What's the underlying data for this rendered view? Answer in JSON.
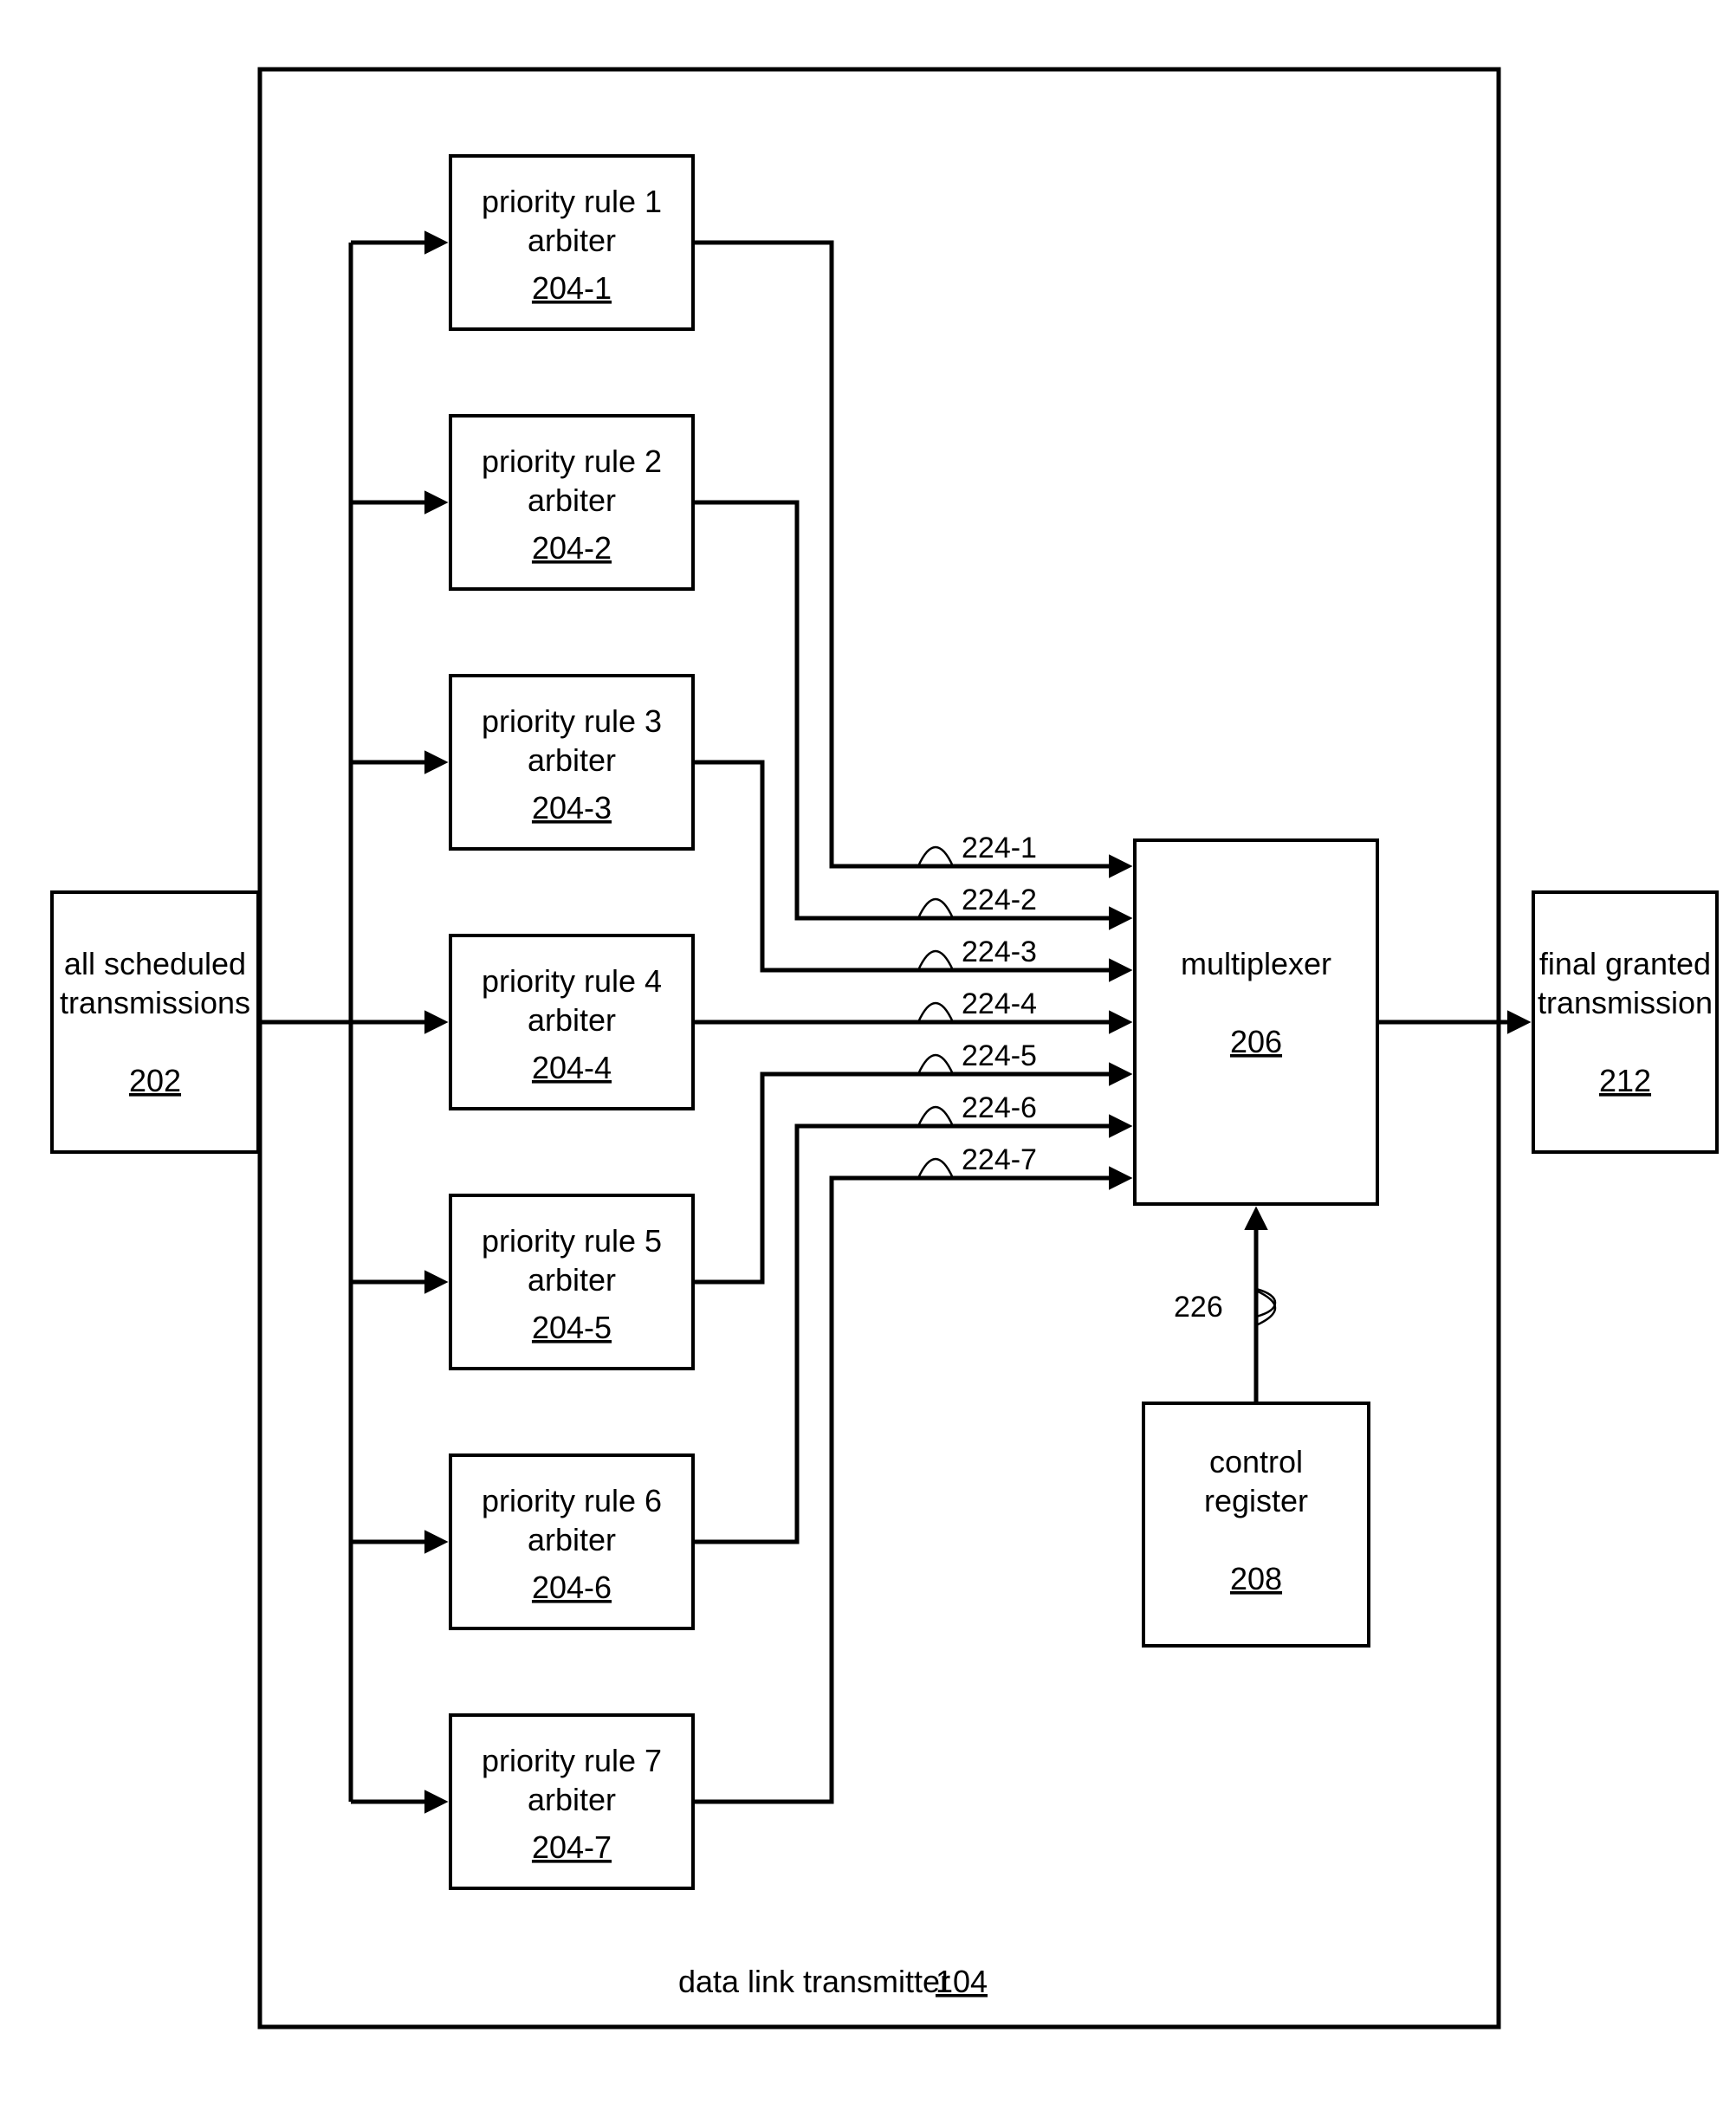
{
  "input_block": {
    "line1": "all scheduled",
    "line2": "transmissions",
    "ref": "202"
  },
  "arbiters": [
    {
      "line1": "priority rule 1",
      "line2": "arbiter",
      "ref": "204-1"
    },
    {
      "line1": "priority rule 2",
      "line2": "arbiter",
      "ref": "204-2"
    },
    {
      "line1": "priority rule 3",
      "line2": "arbiter",
      "ref": "204-3"
    },
    {
      "line1": "priority rule 4",
      "line2": "arbiter",
      "ref": "204-4"
    },
    {
      "line1": "priority rule 5",
      "line2": "arbiter",
      "ref": "204-5"
    },
    {
      "line1": "priority rule 6",
      "line2": "arbiter",
      "ref": "204-6"
    },
    {
      "line1": "priority rule 7",
      "line2": "arbiter",
      "ref": "204-7"
    }
  ],
  "mux": {
    "label": "multiplexer",
    "ref": "206"
  },
  "control": {
    "line1": "control",
    "line2": "register",
    "ref": "208"
  },
  "output_block": {
    "line1": "final granted",
    "line2": "transmission",
    "ref": "212"
  },
  "wire_labels": [
    "224-1",
    "224-2",
    "224-3",
    "224-4",
    "224-5",
    "224-6",
    "224-7"
  ],
  "control_wire_label": "226",
  "container": {
    "label": "data link transmitter",
    "ref": "104"
  }
}
